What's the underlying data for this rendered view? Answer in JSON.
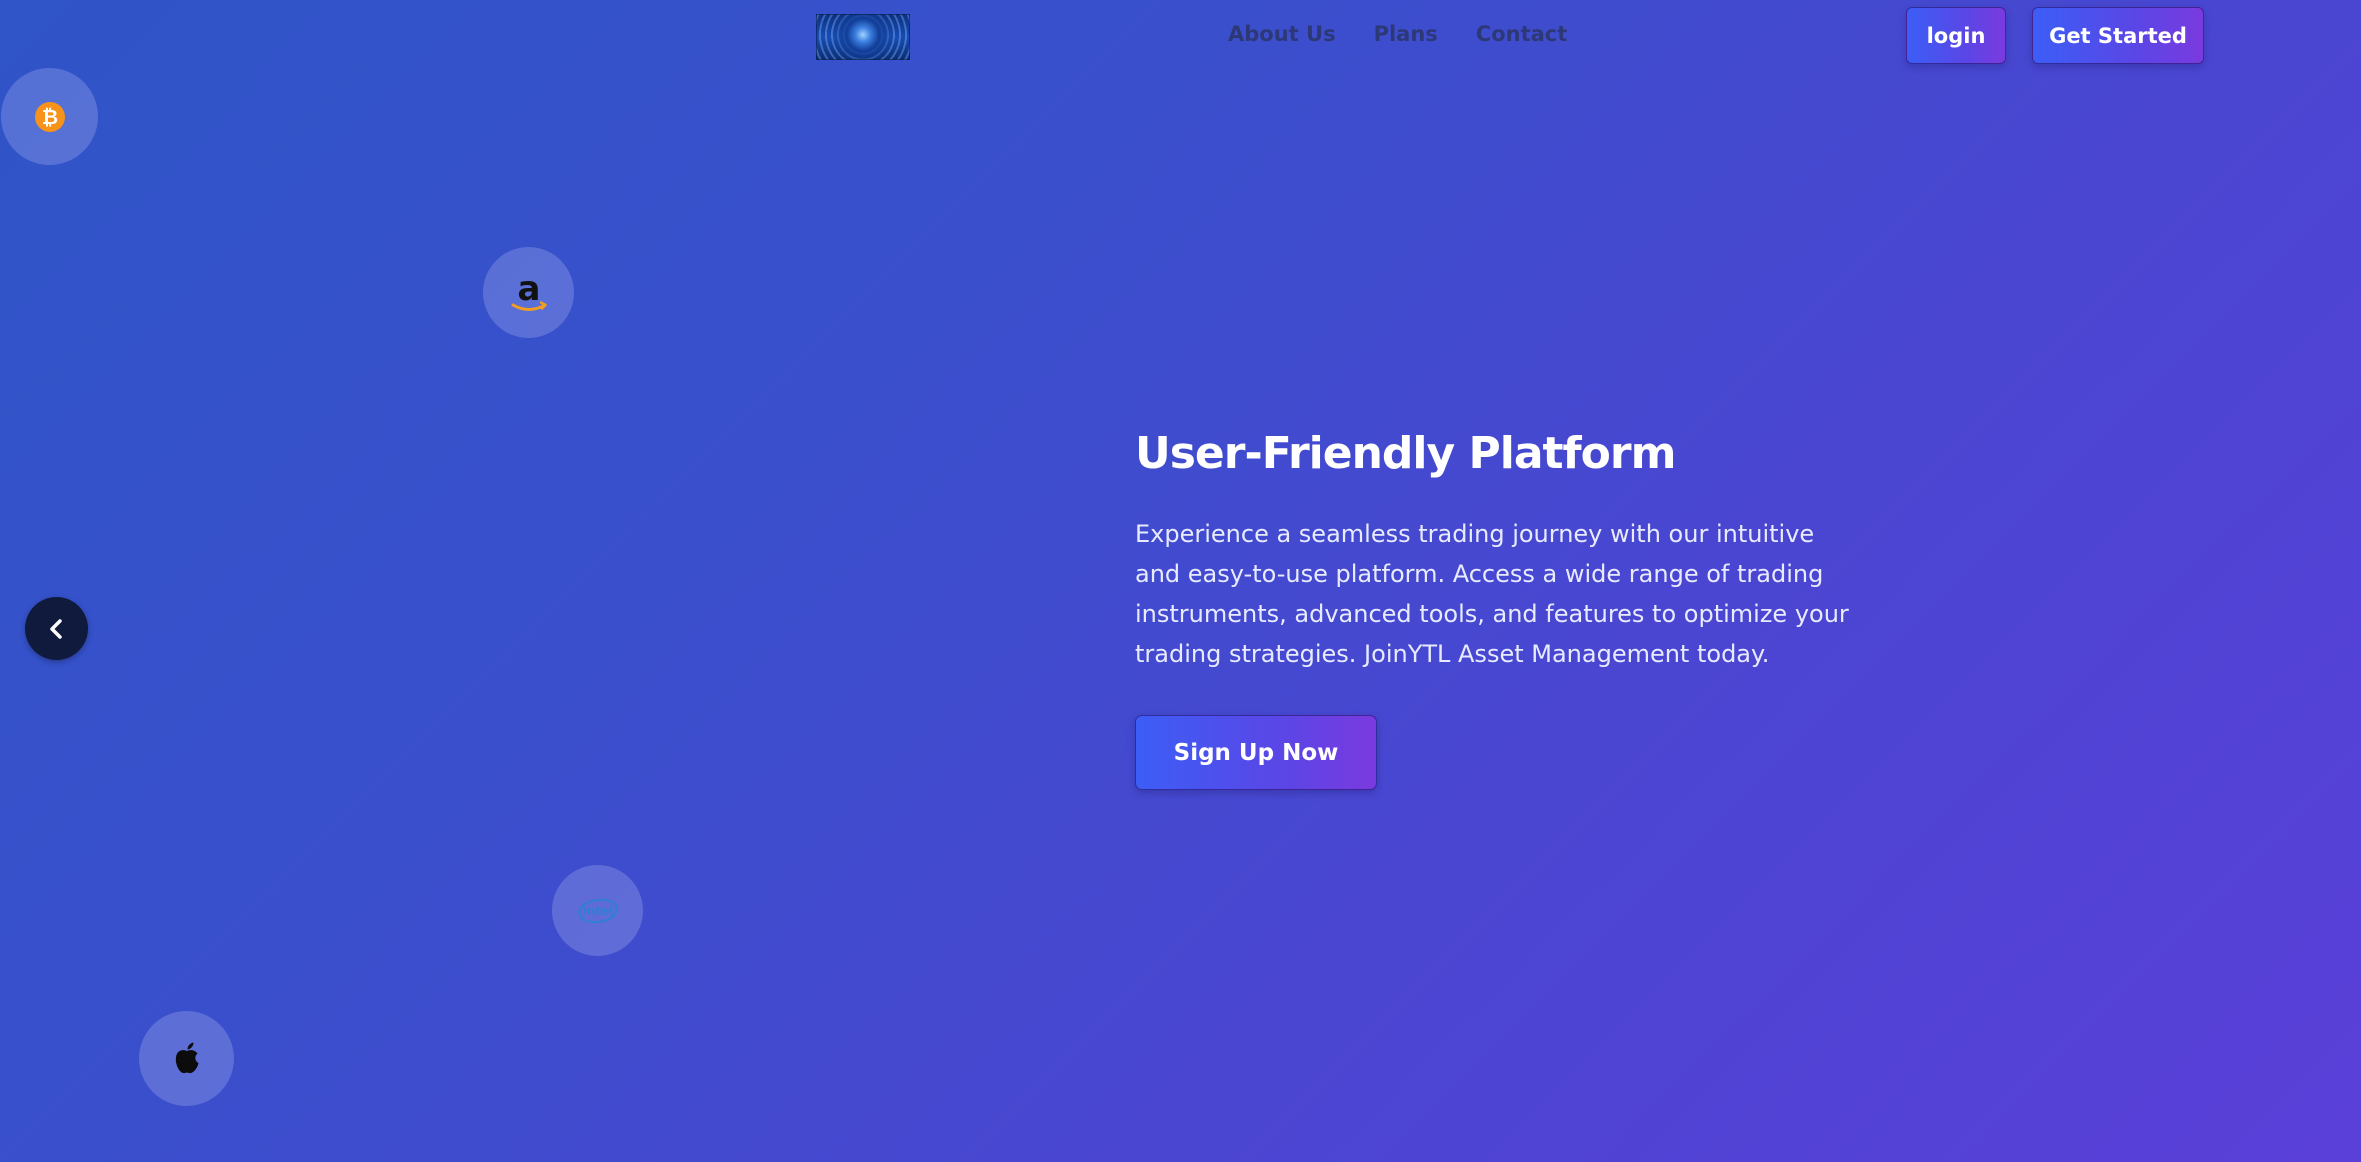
{
  "header": {
    "logo_icon": "eye-globe-logo",
    "nav": [
      {
        "label": "About Us"
      },
      {
        "label": "Plans"
      },
      {
        "label": "Contact"
      }
    ],
    "login_label": "login",
    "get_started_label": "Get Started"
  },
  "badges": [
    {
      "icon": "bitcoin-icon"
    },
    {
      "icon": "amazon-icon",
      "glyph": "a"
    },
    {
      "icon": "intel-icon",
      "glyph": "intel"
    },
    {
      "icon": "apple-icon"
    }
  ],
  "carousel": {
    "prev_icon": "chevron-left-icon"
  },
  "hero": {
    "title": "User-Friendly Platform",
    "description": "Experience a seamless trading journey with our intuitive and easy-to-use platform. Access a wide range of trading instruments, advanced tools, and features to optimize your trading strategies. JoinYTL Asset Management today.",
    "cta_label": "Sign Up Now"
  },
  "colors": {
    "gradient_start": "#2f55c8",
    "gradient_end": "#5a3fd8",
    "button_start": "#3c5ef6",
    "button_end": "#7a3adf",
    "arrow_bg": "#0f1a3d",
    "nav_text": "#2b3569"
  }
}
